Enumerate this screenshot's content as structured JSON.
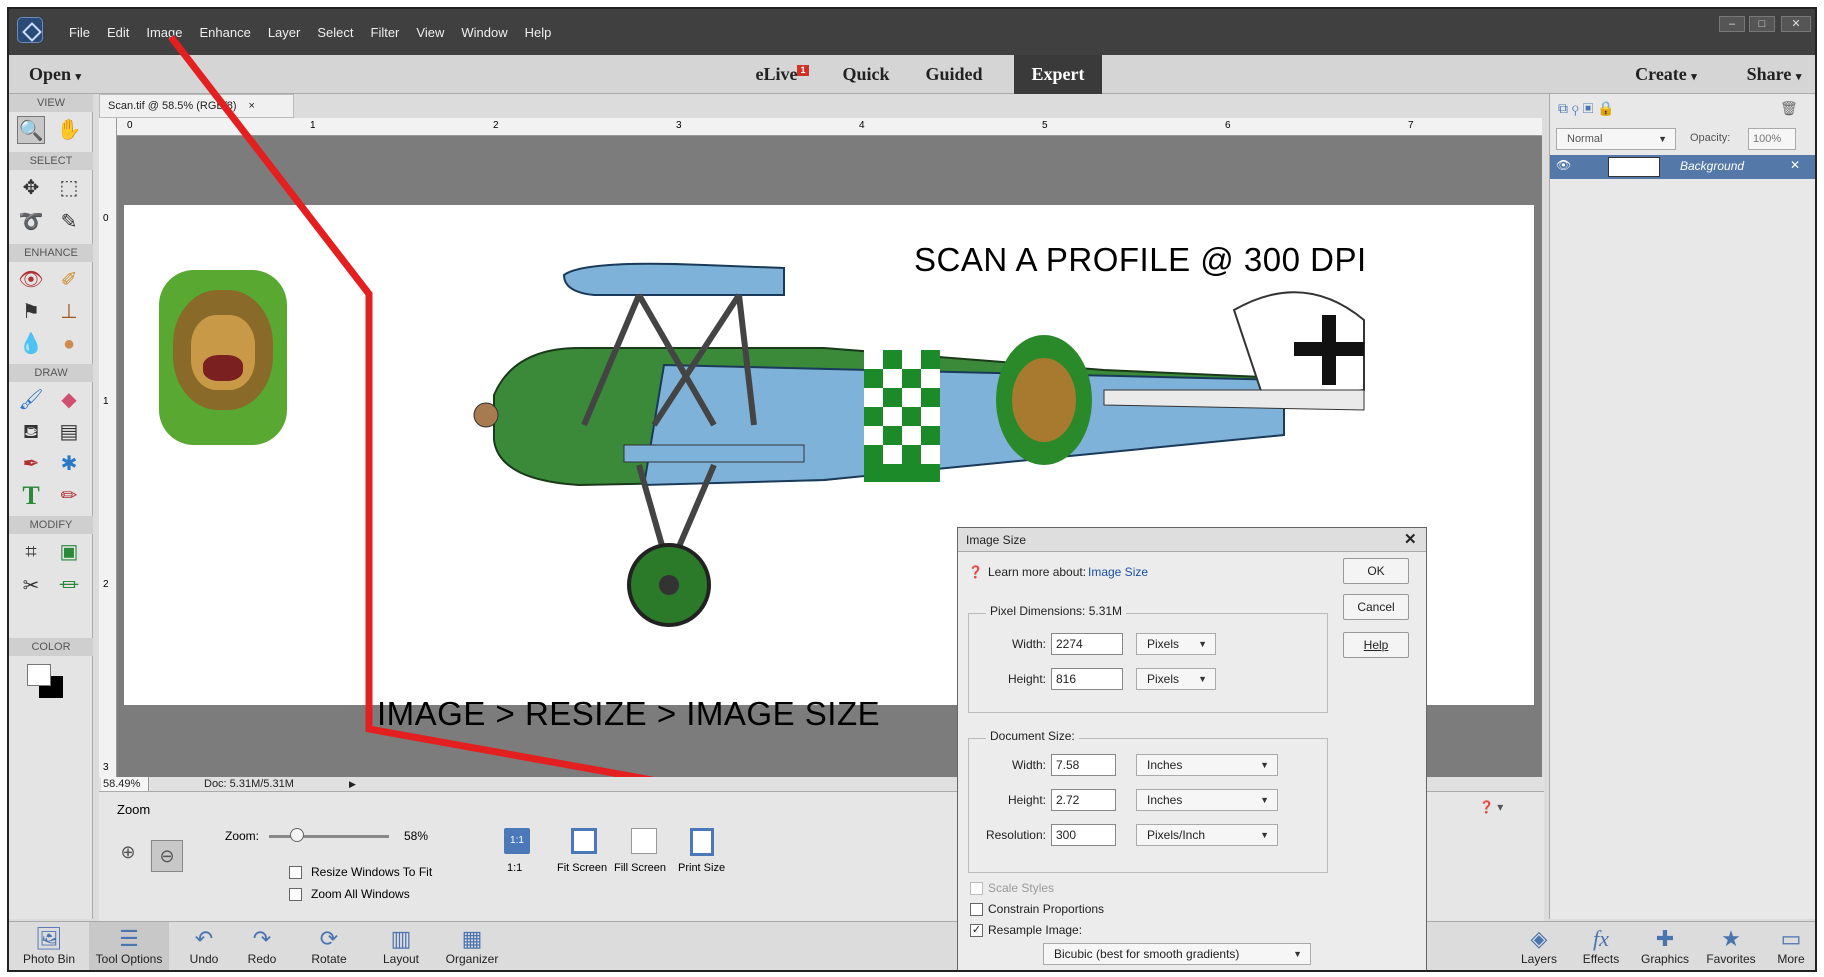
{
  "menu": [
    "File",
    "Edit",
    "Image",
    "Enhance",
    "Layer",
    "Select",
    "Filter",
    "View",
    "Window",
    "Help"
  ],
  "modebar": {
    "open": "Open",
    "elive": "eLive",
    "elive_badge": "1",
    "quick": "Quick",
    "guided": "Guided",
    "expert": "Expert",
    "create": "Create",
    "share": "Share"
  },
  "toolbox": {
    "view": "VIEW",
    "select": "SELECT",
    "enhance": "ENHANCE",
    "draw": "DRAW",
    "modify": "MODIFY",
    "color": "COLOR"
  },
  "document": {
    "tab": "Scan.tif @ 58.5% (RGB/8)",
    "zoom_value": "58.49%",
    "doc_size": "Doc: 5.31M/5.31M",
    "ruler_h": [
      "0",
      "1",
      "2",
      "3",
      "4",
      "5",
      "6",
      "7"
    ],
    "ruler_v": [
      "0",
      "1",
      "2",
      "3"
    ]
  },
  "annotations": {
    "scan_text": "SCAN A PROFILE @ 300 DPI",
    "menu_path": "IMAGE > RESIZE > IMAGE SIZE"
  },
  "tool_options": {
    "title": "Zoom",
    "zoom_label": "Zoom:",
    "zoom_percent": "58%",
    "zoom_level": 0.58,
    "resize_windows": "Resize Windows To Fit",
    "zoom_all": "Zoom All Windows",
    "one_to_one": "1:1",
    "fit_screen": "Fit Screen",
    "fill_screen": "Fill Screen",
    "print_size": "Print Size"
  },
  "layers": {
    "blend_mode": "Normal",
    "opacity_label": "Opacity:",
    "opacity_value": "100%",
    "layer_name": "Background"
  },
  "taskbar": {
    "photo_bin": "Photo Bin",
    "tool_options": "Tool Options",
    "undo": "Undo",
    "redo": "Redo",
    "rotate": "Rotate",
    "layout": "Layout",
    "organizer": "Organizer",
    "layers": "Layers",
    "effects": "Effects",
    "graphics": "Graphics",
    "favorites": "Favorites",
    "more": "More"
  },
  "dialog": {
    "title": "Image Size",
    "learn_prefix": "Learn more about:",
    "learn_link": "Image Size",
    "ok": "OK",
    "cancel": "Cancel",
    "help": "Help",
    "pixel_dims": "Pixel Dimensions:  5.31M",
    "px_width_label": "Width:",
    "px_width": "2274",
    "px_width_unit": "Pixels",
    "px_height_label": "Height:",
    "px_height": "816",
    "px_height_unit": "Pixels",
    "doc_size": "Document Size:",
    "doc_width_label": "Width:",
    "doc_width": "7.58",
    "doc_width_unit": "Inches",
    "doc_height_label": "Height:",
    "doc_height": "2.72",
    "doc_height_unit": "Inches",
    "res_label": "Resolution:",
    "res_value": "300",
    "res_unit": "Pixels/Inch",
    "scale_styles": "Scale Styles",
    "constrain": "Constrain Proportions",
    "resample": "Resample Image:",
    "resample_method": "Bicubic (best for smooth gradients)"
  }
}
